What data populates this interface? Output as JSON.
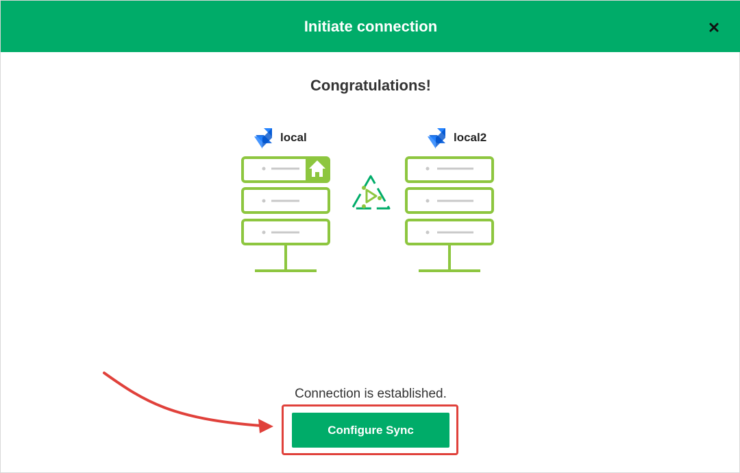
{
  "dialog": {
    "title": "Initiate connection",
    "close_icon": "close-icon"
  },
  "content": {
    "heading": "Congratulations!",
    "local_node": {
      "label": "local",
      "icon": "jira-logo-icon",
      "home_icon": "home-icon"
    },
    "remote_node": {
      "label": "local2",
      "icon": "jira-logo-icon"
    },
    "connector_icon": "exalate-connection-icon",
    "status": "Connection is established.",
    "configure_button_label": "Configure Sync"
  },
  "colors": {
    "header": "#00ac69",
    "button": "#00ac69",
    "server_outline": "#8dc63f",
    "highlight": "#e0413b",
    "annotation_arrow": "#e0413b"
  }
}
